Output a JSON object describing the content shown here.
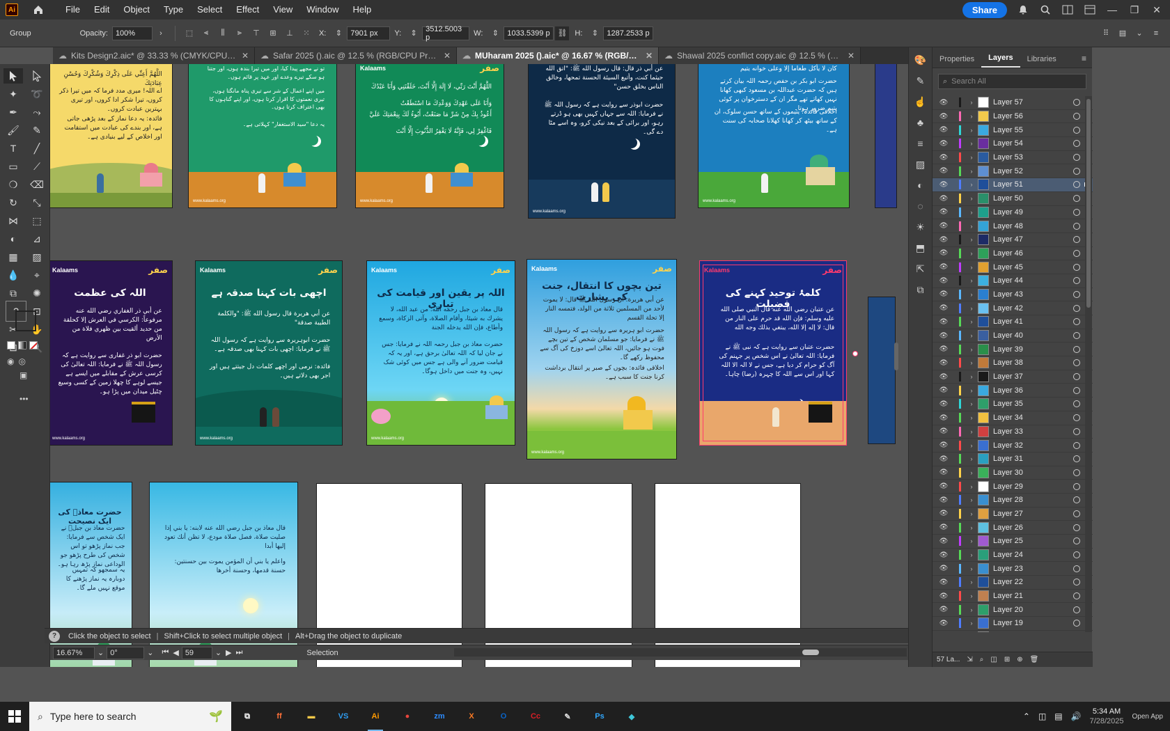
{
  "app": {
    "logo_text": "Ai",
    "menu": [
      "File",
      "Edit",
      "Object",
      "Type",
      "Select",
      "Effect",
      "View",
      "Window",
      "Help"
    ],
    "share_label": "Share"
  },
  "control_bar": {
    "selection_type": "Group",
    "opacity_label": "Opacity:",
    "opacity_value": "100%",
    "x_label": "X:",
    "x_value": "7901 px",
    "y_label": "Y:",
    "y_value": "3512.5003 p",
    "w_label": "W:",
    "w_value": "1033.5399 p",
    "h_label": "H:",
    "h_value": "1287.2533 p"
  },
  "tabs": [
    {
      "title": "Kits Design2.aic* @ 33.33 % (CMYK/CPU Preview)",
      "active": false
    },
    {
      "title": "Safar 2025 ().aic @ 12.5 % (RGB/CPU Preview)",
      "active": false
    },
    {
      "title": "MUharam 2025 ().aic* @ 16.67 % (RGB/CPU Preview)",
      "active": true
    },
    {
      "title": "Shawal 2025 conflict copy.aic @ 12.5 % (RGB/CPU Preview)",
      "active": false
    }
  ],
  "artboards": [
    {
      "id": "a1",
      "bg": "#f5d96a",
      "title": "",
      "lines": [
        "اللَّهُمَّ أَعِنِّي عَلَى ذِكْرِكَ وَشُكْرِكَ وَحُسْنِ عِبَادَتِكَ",
        "اے اللہ! میری مدد فرما کہ میں تیرا ذکر کروں، تیرا شکر ادا کروں، اور تیری بہترین عبادت کروں۔",
        "فائدہ: یہ دعا نماز کے بعد پڑھی جاتی ہے، اور بندے کی عبادت میں استقامت اور اخلاص کے لیے بنیادی ہے۔"
      ]
    },
    {
      "id": "a2",
      "bg": "#1f9a6a",
      "title": "",
      "lines": [
        "تو نے مجھے پیدا کیا، اور میں تیرا بندہ ہوں، اور جتنا ہو سکے تیرے وعدے اور عہد پر قائم ہوں۔",
        "میں اپنے اعمال کے شر سے تیری پناہ مانگتا ہوں، تیری نعمتوں کا اقرار کرتا ہوں، اور اپنے گناہوں کا بھی اعتراف کرتا ہوں۔",
        "یہ دعا \"سید الاستغفار\" کہلاتی ہے۔"
      ]
    },
    {
      "id": "a3",
      "bg": "#118a57",
      "title": "",
      "lines": [
        "اللَّهُمَّ أَنْتَ رَبِّي، لَا إِلَهَ إِلَّا أَنْتَ، خَلَقْتَنِي وَأَنَا عَبْدُكَ",
        "وَأَنَا عَلَى عَهْدِكَ وَوَعْدِكَ مَا اسْتَطَعْتُ",
        "أَعُوذُ بِكَ مِنْ شَرِّ مَا صَنَعْتُ، أَبُوءُ لَكَ بِنِعْمَتِكَ عَلَيَّ",
        "فَاغْفِرْ لِي، فَإِنَّهُ لَا يَغْفِرُ الذُّنُوبَ إِلَّا أَنْتَ"
      ]
    },
    {
      "id": "a4",
      "bg": "#0e2a47",
      "title": "",
      "lines": [
        "عن أبي ذر قال: قال رسول الله ﷺ: \"اتق الله حيثما كنت، وأتبع السيئة الحسنة تمحها، وخالق الناس بخلق حسن\"",
        "حضرت ابوذر سے روایت ہے کہ رسول اللہ ﷺ نے فرمایا: اللہ سے جہاں کہیں بھی ہو ڈرتے رہو، اور برائی کے بعد نیکی کرو، وہ اسے مٹا دے گی۔"
      ]
    },
    {
      "id": "a5",
      "bg": "#1c7fbf",
      "title": "",
      "lines": [
        "كان لا يأكل طعاما إلا وعلى خوانه يتيم",
        "حضرت ابو بکر بن حفص رحمہ اللہ بیان کرتے ہیں کہ حضرت عبداللہ بن مسعود کبھی کھانا نہیں کھاتے تھے مگر ان کے دسترخوان پر کوئی یتیم ضرور ہوتا۔",
        "اخلاقی فائدہ: یتیموں کے ساتھ حسن سلوک، ان کے ساتھ بیٹھ کر کھانا کھلانا صحابہ کی سنت ہے۔"
      ]
    },
    {
      "id": "b1",
      "bg": "#2a1550",
      "title": "اللہ کی عظمت",
      "lines": [
        "عن أبي ذر الغفاري رضي الله عنه مرفوعاً: الكرسي في العرش إلا كحلقة من حديد ألقيت بين ظهري فلاة من الأرض",
        "حضرت ابو ذر غفاری سے روایت ہے کہ رسول اللہ ﷺ نے فرمایا: اللہ تعالیٰ کی کرسی عرش کے مقابلے میں ایسے ہے جیسے لوہے کا چھلا زمین کے کسی وسیع چٹیل میدان میں پڑا ہو۔"
      ]
    },
    {
      "id": "b2",
      "bg": "#0f6b5e",
      "title": "اچھی بات کہنا صدقہ ہے",
      "lines": [
        "عن أبي هريرة قال رسول الله ﷺ: \"والكلمة الطيبة صدقة\"",
        "حضرت ابوہریرہ سے روایت ہے کہ رسول اللہ ﷺ نے فرمایا: اچھی بات کہنا بھی صدقہ ہے۔",
        "فائدہ: نرمی اور اچھے کلمات دل جیتتے ہیں اور اجر بھی دلاتے ہیں۔"
      ]
    },
    {
      "id": "b3",
      "bg": "#35b6e8",
      "title": "اللہ پر یقین اور قیامت کی تیاری",
      "lines": [
        "قال معاذ بن جبل رحمه الله: من عبد الله، لا يشرك به شيئا، وأقام الصلاة، وآتى الزكاة، وسمع وأطاع، فإن الله يدخله الجنة",
        "حضرت معاذ بن جبل رحمہ اللہ نے فرمایا: جس نے جان لیا کہ اللہ تعالیٰ برحق ہے، اور یہ کہ قیامت ضرور آنے والی ہے جس میں کوئی شک نہیں، وہ جنت میں داخل ہوگا۔"
      ]
    },
    {
      "id": "b4",
      "bg": "#39a5e0",
      "title": "تین بچوں کا انتقال، جنت کی بشارت",
      "lines": [
        "عن أبي هريرة: أن رسول الله ﷺ قال: لا يموت لأحد من المسلمين ثلاثة من الولد، فتمسه النار إلا تحلة القسم",
        "حضرت ابو ہریرہ سے روایت ہے کہ رسول اللہ ﷺ نے فرمایا: جو مسلمان شخص کے تین بچے فوت ہو جائیں، اللہ تعالیٰ اسے دوزخ کی آگ سے محفوظ رکھے گا۔",
        "اخلاقی فائدہ: بچوں کے صبر پر انتقال برداشت کرنا جنت کا سبب ہے۔"
      ]
    },
    {
      "id": "b5",
      "bg": "#1a2c84",
      "title": "کلمۂ توحید کہنے کی فضیلت",
      "lines": [
        "عن عتبان رضي الله عنه قال النبي صلى الله عليه وسلم: فإن الله قد حرم على النار من قال: لا إله إلا الله، يبتغي بذلك وجه الله",
        "حضرت عتبان سے روایت ہے کہ نبی ﷺ نے فرمایا: اللہ تعالیٰ نے اس شخص پر جہنم کی آگ کو حرام کر دیا ہے، جس نے لا الہ الا اللہ کہا اور اس سے اللہ کا چہرہ (رضا) چاہا۔"
      ]
    },
    {
      "id": "c1",
      "bg": "#38b6e0",
      "title": "حضرت معاذؓ کی ایک نصیحت",
      "lines": [
        "حضرت معاذ بن جبلؓ نے ایک شخص سے فرمایا: جب نماز پڑھو تو اس شخص کی طرح پڑھو جو الوداعی نماز پڑھ رہا ہو۔",
        "یہ سمجھو کہ تمہیں دوبارہ یہ نماز پڑھنے کا موقع نہیں ملے گا۔"
      ]
    },
    {
      "id": "c2",
      "bg": "#3ec0e6",
      "title": "",
      "lines": [
        "قال معاذ بن جبل رضي الله عنه لابنه: يا بني إذا صليت صلاة، فصل صلاة مودع، لا تظن أنك تعود إليها أبدا",
        "واعلم يا بني أن المؤمن يموت بين حسنتين: حسنة قدمها، وحسنة أخرها"
      ]
    }
  ],
  "artboard_meta": {
    "brand_logo": "Kalaams",
    "brand_mark": "صفر",
    "footer_url": "www.kalaams.org"
  },
  "layers": {
    "panel_tabs": [
      "Properties",
      "Layers",
      "Libraries"
    ],
    "active_tab": "Layers",
    "search_placeholder": "Search All",
    "items": [
      {
        "name": "Layer 57",
        "color": "#1a1a1a",
        "thumb": "#ffffff",
        "selected": false
      },
      {
        "name": "Layer 56",
        "color": "#ff69b4",
        "thumb": "#f2c94c",
        "selected": false
      },
      {
        "name": "Layer 55",
        "color": "#2fd6d6",
        "thumb": "#3aa9e0",
        "selected": false
      },
      {
        "name": "Layer 54",
        "color": "#c03cff",
        "thumb": "#6a2ea0",
        "selected": false
      },
      {
        "name": "Layer 53",
        "color": "#ff4a4a",
        "thumb": "#2a5ba0",
        "selected": false
      },
      {
        "name": "Layer 52",
        "color": "#57d957",
        "thumb": "#5e8fd1",
        "selected": false
      },
      {
        "name": "Layer 51",
        "color": "#4f7dff",
        "thumb": "#1f4f9a",
        "selected": true
      },
      {
        "name": "Layer 50",
        "color": "#ffd24a",
        "thumb": "#2a8f6a",
        "selected": false
      },
      {
        "name": "Layer 49",
        "color": "#5bb8ff",
        "thumb": "#1e9f8c",
        "selected": false
      },
      {
        "name": "Layer 48",
        "color": "#ff69b4",
        "thumb": "#34a3d6",
        "selected": false
      },
      {
        "name": "Layer 47",
        "color": "#1a1a1a",
        "thumb": "#1d2b66",
        "selected": false
      },
      {
        "name": "Layer 46",
        "color": "#57d957",
        "thumb": "#2ea05a",
        "selected": false
      },
      {
        "name": "Layer 45",
        "color": "#c03cff",
        "thumb": "#e0a030",
        "selected": false
      },
      {
        "name": "Layer 44",
        "color": "#1a1a1a",
        "thumb": "#3cb0e0",
        "selected": false
      },
      {
        "name": "Layer 43",
        "color": "#5bb8ff",
        "thumb": "#2a7fd0",
        "selected": false
      },
      {
        "name": "Layer 42",
        "color": "#4f7dff",
        "thumb": "#6ac0f0",
        "selected": false
      },
      {
        "name": "Layer 41",
        "color": "#57d957",
        "thumb": "#1f4f9a",
        "selected": false
      },
      {
        "name": "Layer 40",
        "color": "#5bb8ff",
        "thumb": "#3a5fa0",
        "selected": false
      },
      {
        "name": "Layer 39",
        "color": "#57d957",
        "thumb": "#2a8f4a",
        "selected": false
      },
      {
        "name": "Layer 38",
        "color": "#ff4a4a",
        "thumb": "#c07a3a",
        "selected": false
      },
      {
        "name": "Layer 37",
        "color": "#1a1a1a",
        "thumb": "#1a1a1a",
        "selected": false
      },
      {
        "name": "Layer 36",
        "color": "#ffd24a",
        "thumb": "#3aa9e0",
        "selected": false
      },
      {
        "name": "Layer 35",
        "color": "#2fd6d6",
        "thumb": "#2e9f6a",
        "selected": false
      },
      {
        "name": "Layer 34",
        "color": "#57d957",
        "thumb": "#f0c040",
        "selected": false
      },
      {
        "name": "Layer 33",
        "color": "#ff69b4",
        "thumb": "#d04040",
        "selected": false
      },
      {
        "name": "Layer 32",
        "color": "#ff4a4a",
        "thumb": "#3a6fd0",
        "selected": false
      },
      {
        "name": "Layer 31",
        "color": "#57d957",
        "thumb": "#2aa0c0",
        "selected": false
      },
      {
        "name": "Layer 30",
        "color": "#ffd24a",
        "thumb": "#3ab05a",
        "selected": false
      },
      {
        "name": "Layer 29",
        "color": "#ff4a4a",
        "thumb": "#ffffff",
        "selected": false
      },
      {
        "name": "Layer 28",
        "color": "#4f7dff",
        "thumb": "#3a8fd0",
        "selected": false
      },
      {
        "name": "Layer 27",
        "color": "#ffd24a",
        "thumb": "#e0a040",
        "selected": false
      },
      {
        "name": "Layer 26",
        "color": "#57d957",
        "thumb": "#5ec0e0",
        "selected": false
      },
      {
        "name": "Layer 25",
        "color": "#c03cff",
        "thumb": "#a05ad0",
        "selected": false
      },
      {
        "name": "Layer 24",
        "color": "#57d957",
        "thumb": "#2a9f7a",
        "selected": false
      },
      {
        "name": "Layer 23",
        "color": "#5bb8ff",
        "thumb": "#3a8fd0",
        "selected": false
      },
      {
        "name": "Layer 22",
        "color": "#4f7dff",
        "thumb": "#1f4f9a",
        "selected": false
      },
      {
        "name": "Layer 21",
        "color": "#ff4a4a",
        "thumb": "#c08050",
        "selected": false
      },
      {
        "name": "Layer 20",
        "color": "#57d957",
        "thumb": "#2e9f6a",
        "selected": false
      },
      {
        "name": "Layer 19",
        "color": "#4f7dff",
        "thumb": "#3a6fd0",
        "selected": false
      },
      {
        "name": "Layer 18",
        "color": "#c03cff",
        "thumb": "#3a8fd0",
        "selected": false
      }
    ],
    "footer_count": "57 La..."
  },
  "hint_bar": {
    "q": "?",
    "items": [
      "Click the object to select",
      "Shift+Click to select multiple object",
      "Alt+Drag the object to duplicate"
    ]
  },
  "status_bar": {
    "zoom": "16.67%",
    "rotation": "0°",
    "artboard_number": "59",
    "mode": "Selection"
  },
  "taskbar": {
    "search_placeholder": "Type here to search",
    "apps": [
      {
        "name": "task-view",
        "label": "⧉",
        "color": "#ffffff",
        "active": false
      },
      {
        "name": "firefox",
        "label": "ff",
        "color": "#ff7139",
        "active": false
      },
      {
        "name": "file-explorer",
        "label": "▬",
        "color": "#f7c948",
        "active": false
      },
      {
        "name": "vscode",
        "label": "VS",
        "color": "#2f9cf0",
        "active": false
      },
      {
        "name": "illustrator",
        "label": "Ai",
        "color": "#ff9a00",
        "active": true
      },
      {
        "name": "chrome",
        "label": "●",
        "color": "#e8453c",
        "active": false
      },
      {
        "name": "zoom",
        "label": "zm",
        "color": "#2d8cff",
        "active": false
      },
      {
        "name": "xampp",
        "label": "X",
        "color": "#fb7a24",
        "active": false
      },
      {
        "name": "outlook",
        "label": "O",
        "color": "#0a64c8",
        "active": false
      },
      {
        "name": "creative-cloud",
        "label": "Cc",
        "color": "#da1f26",
        "active": false
      },
      {
        "name": "pen-tool",
        "label": "✎",
        "color": "#dddddd",
        "active": false
      },
      {
        "name": "photoshop",
        "label": "Ps",
        "color": "#31a8ff",
        "active": false
      },
      {
        "name": "gem-app",
        "label": "◆",
        "color": "#3fc7d8",
        "active": false
      }
    ],
    "time": "5:34 AM",
    "date": "7/28/2025",
    "tray_label": "Open App"
  }
}
